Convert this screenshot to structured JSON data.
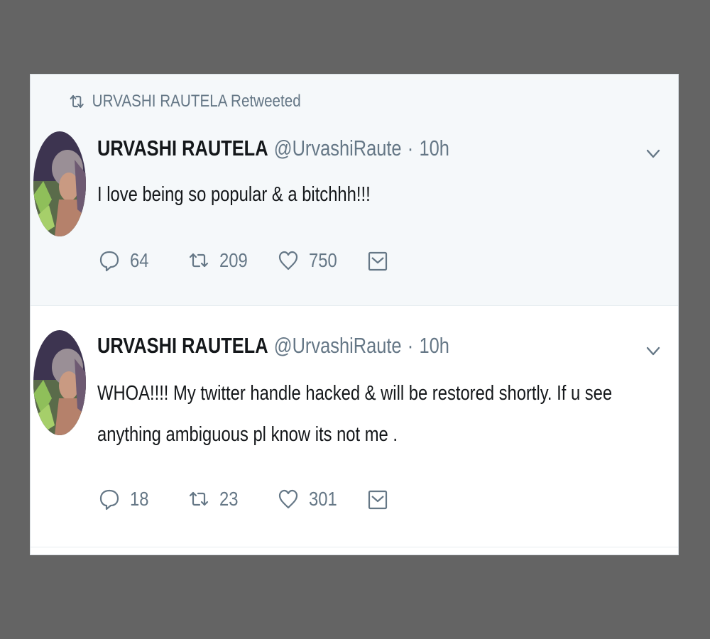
{
  "retweet_banner": {
    "text": "URVASHI RAUTELA Retweeted",
    "icon": "retweet-icon"
  },
  "tweets": [
    {
      "name": "URVASHI RAUTELA",
      "handle": "@UrvashiRaute",
      "dot": "·",
      "time": "10h",
      "text": "I love being so popular & a bitchhh!!!",
      "replies": "64",
      "retweets": "209",
      "likes": "750"
    },
    {
      "name": "URVASHI RAUTELA",
      "handle": "@UrvashiRaute",
      "dot": "·",
      "time": "10h",
      "text": "WHOA!!!! My twitter handle hacked & will be restored shortly. If u see anything ambiguous pl know its not me .",
      "replies": "18",
      "retweets": "23",
      "likes": "301"
    }
  ],
  "icons": {
    "reply": "reply-icon",
    "retweet": "retweet-icon",
    "like": "heart-icon",
    "message": "direct-message-icon",
    "more": "chevron-down-icon"
  },
  "colors": {
    "background": "#646464",
    "card": "#ffffff",
    "retweeted_tweet_bg": "#f5f8fa",
    "text": "#14171a",
    "muted": "#657786"
  }
}
